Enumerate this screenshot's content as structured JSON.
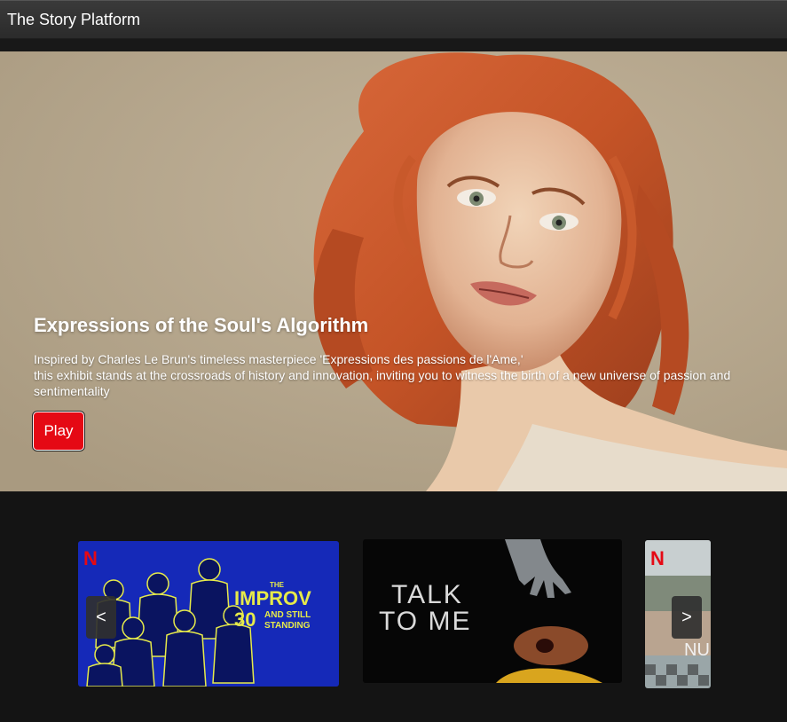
{
  "app": {
    "title": "The Story Platform"
  },
  "hero": {
    "title": "Expressions of the Soul's Algorithm",
    "description_lines": [
      "Inspired by Charles Le Brun's timeless masterpiece 'Expressions des passions de l'Ame,'",
      "this exhibit stands at the crossroads of history and innovation, inviting you to witness the birth of a new universe of passion and sentimentality"
    ],
    "play_label": "Play",
    "image_icon": "portrait-illustration"
  },
  "carousel": {
    "prev_label": "<",
    "next_label": ">",
    "items": [
      {
        "logo": "N",
        "title_lines": [
          "THE",
          "IMPROV",
          "30",
          "AND STILL",
          "STANDING"
        ]
      },
      {
        "logo": "",
        "title_lines": [
          "TALK",
          "TO ME"
        ]
      },
      {
        "logo": "N",
        "title_lines": [
          "NU"
        ]
      }
    ]
  },
  "colors": {
    "play": "#e50914",
    "netflix_red": "#e50914",
    "improv_blue": "#1930c8",
    "improv_yellow": "#e6ea4a"
  }
}
